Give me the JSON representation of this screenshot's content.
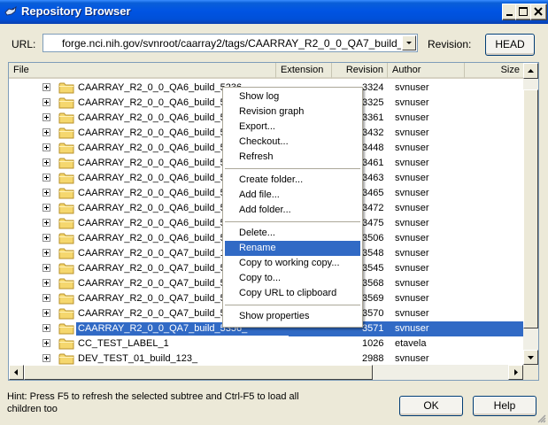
{
  "window": {
    "title": "Repository Browser",
    "minimize_icon": "minimize-icon",
    "maximize_icon": "maximize-icon",
    "close_icon": "close-icon"
  },
  "url_bar": {
    "label": "URL:",
    "value": "forge.nci.nih.gov/svnroot/caarray2/tags/CAARRAY_R2_0_0_QA7_build_5356_",
    "revision_label": "Revision:",
    "head_button": "HEAD"
  },
  "columns": [
    "File",
    "Extension",
    "Revision",
    "Author",
    "Size"
  ],
  "rows": [
    {
      "name": "CAARRAY_R2_0_0_QA6_build_5236",
      "revision": "3324",
      "author": "svnuser"
    },
    {
      "name": "CAARRAY_R2_0_0_QA6_build_52",
      "revision": "3325",
      "author": "svnuser"
    },
    {
      "name": "CAARRAY_R2_0_0_QA6_build_52",
      "revision": "3361",
      "author": "svnuser"
    },
    {
      "name": "CAARRAY_R2_0_0_QA6_build_52",
      "revision": "3432",
      "author": "svnuser"
    },
    {
      "name": "CAARRAY_R2_0_0_QA6_build_52",
      "revision": "3448",
      "author": "svnuser"
    },
    {
      "name": "CAARRAY_R2_0_0_QA6_build_53",
      "revision": "3461",
      "author": "svnuser"
    },
    {
      "name": "CAARRAY_R2_0_0_QA6_build_53",
      "revision": "3463",
      "author": "svnuser"
    },
    {
      "name": "CAARRAY_R2_0_0_QA6_build_53",
      "revision": "3465",
      "author": "svnuser"
    },
    {
      "name": "CAARRAY_R2_0_0_QA6_build_53",
      "revision": "3472",
      "author": "svnuser"
    },
    {
      "name": "CAARRAY_R2_0_0_QA6_build_53",
      "revision": "3475",
      "author": "svnuser"
    },
    {
      "name": "CAARRAY_R2_0_0_QA6_build_53",
      "revision": "3506",
      "author": "svnuser"
    },
    {
      "name": "CAARRAY_R2_0_0_QA7_build_16",
      "revision": "3548",
      "author": "svnuser"
    },
    {
      "name": "CAARRAY_R2_0_0_QA7_build_53",
      "revision": "3545",
      "author": "svnuser"
    },
    {
      "name": "CAARRAY_R2_0_0_QA7_build_53",
      "revision": "3568",
      "author": "svnuser"
    },
    {
      "name": "CAARRAY_R2_0_0_QA7_build_53",
      "revision": "3569",
      "author": "svnuser"
    },
    {
      "name": "CAARRAY_R2_0_0_QA7_build_53",
      "revision": "3570",
      "author": "svnuser"
    },
    {
      "name": "CAARRAY_R2_0_0_QA7_build_5356_",
      "revision": "3571",
      "author": "svnuser",
      "selected": true
    },
    {
      "name": "CC_TEST_LABEL_1",
      "revision": "1026",
      "author": "etavela"
    },
    {
      "name": "DEV_TEST_01_build_123_",
      "revision": "2988",
      "author": "svnuser"
    }
  ],
  "context_menu": [
    {
      "label": "Show log"
    },
    {
      "label": "Revision graph"
    },
    {
      "label": "Export..."
    },
    {
      "label": "Checkout..."
    },
    {
      "label": "Refresh"
    },
    {
      "separator": true
    },
    {
      "label": "Create folder..."
    },
    {
      "label": "Add file..."
    },
    {
      "label": "Add folder..."
    },
    {
      "separator": true
    },
    {
      "label": "Delete..."
    },
    {
      "label": "Rename",
      "highlighted": true
    },
    {
      "label": "Copy to working copy..."
    },
    {
      "label": "Copy to..."
    },
    {
      "label": "Copy URL to clipboard"
    },
    {
      "separator": true
    },
    {
      "label": "Show properties"
    }
  ],
  "hint": "Hint: Press F5 to refresh the selected subtree and Ctrl-F5 to load all children too",
  "buttons": {
    "ok": "OK",
    "help": "Help"
  },
  "colors": {
    "selection": "#316ac5",
    "titlebar": "#0054e3",
    "folder": "#f5d76e"
  }
}
